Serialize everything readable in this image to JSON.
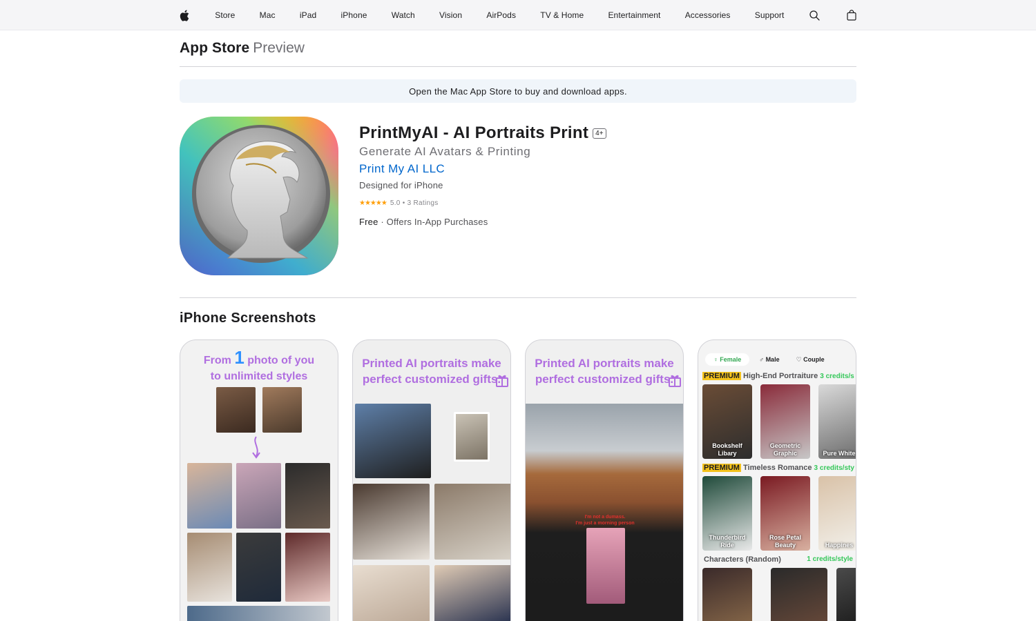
{
  "global_nav": {
    "items": [
      "Store",
      "Mac",
      "iPad",
      "iPhone",
      "Watch",
      "Vision",
      "AirPods",
      "TV & Home",
      "Entertainment",
      "Accessories",
      "Support"
    ]
  },
  "local_nav": {
    "title": "App Store",
    "subtitle": "Preview"
  },
  "banner": {
    "text": "Open the Mac App Store to buy and download apps."
  },
  "product": {
    "title": "PrintMyAI - AI Portraits Print",
    "age_rating": "4+",
    "subtitle": "Generate AI Avatars & Printing",
    "developer": "Print My AI LLC",
    "device": "Designed for iPhone",
    "stars": "★★★★★",
    "rating": "5.0 • 3 Ratings",
    "price": "Free",
    "in_app": "· Offers In-App Purchases"
  },
  "screenshots": {
    "title": "iPhone Screenshots",
    "shot1": {
      "caption_a": "From",
      "caption_num": "1",
      "caption_b": "photo of you",
      "caption_c": "to unlimited styles"
    },
    "shot2": {
      "caption_a": "Printed AI portraits make",
      "caption_b": "perfect customized gifts."
    },
    "shot3": {
      "caption_a": "Printed AI portraits make",
      "caption_b": "perfect customized gifts.",
      "shirt_line1": "I'm not a dumass.",
      "shirt_line2": "I'm just a morning person"
    },
    "shot4": {
      "tabs": [
        "Female",
        "Male",
        "Couple"
      ],
      "sections": [
        {
          "badge": "PREMIUM",
          "title": "High-End Portraiture",
          "credits": "3 credits/s",
          "tiles": [
            "Bookshelf Libary",
            "Geometric Graphic",
            "Pure White"
          ]
        },
        {
          "badge": "PREMIUM",
          "title": "Timeless Romance",
          "credits": "3 credits/sty",
          "tiles": [
            "Thunderbird Ride",
            "Rose Petal Beauty",
            "Happines"
          ]
        },
        {
          "badge": "",
          "title": "Characters (Random)",
          "credits": "1 credits/style",
          "tiles": []
        }
      ]
    }
  },
  "colors": {
    "link": "#0066cc",
    "star": "#ff9f0a",
    "caption": "#b06ee0",
    "premium": "#f4c21b",
    "credits": "#34c759"
  }
}
